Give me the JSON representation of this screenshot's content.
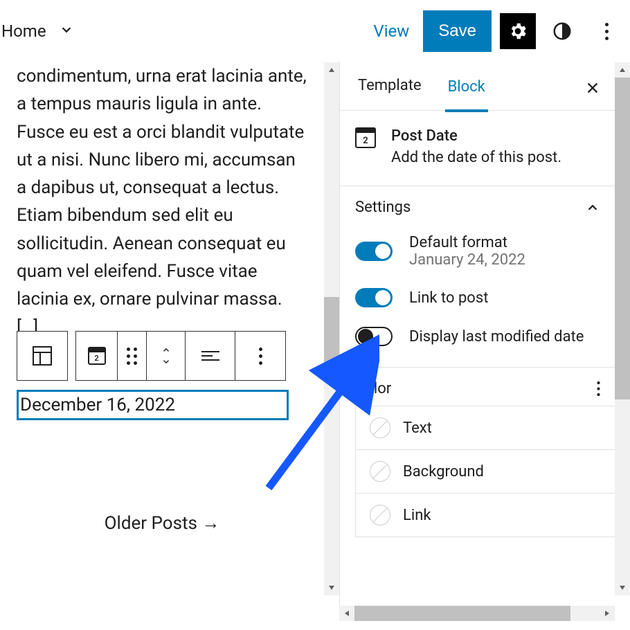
{
  "header": {
    "breadcrumb": "Home",
    "view": "View",
    "save": "Save"
  },
  "editor": {
    "body_text": "condimentum, urna erat lacinia ante, a tempus mauris ligula in ante. Fusce eu est a orci blandit vulputate ut a nisi. Nunc libero mi, accumsan a dapibus ut, consequat a lectus. Etiam bibendum sed elit eu sollicitudin. Aenean consequat eu quam vel eleifend. Fusce vitae lacinia ex, ornare pulvinar massa. […]",
    "date_value": "December 16, 2022",
    "older_posts": "Older Posts  →",
    "calendar_day": "2"
  },
  "sidebar": {
    "tabs": {
      "template": "Template",
      "block": "Block"
    },
    "block_info": {
      "title": "Post Date",
      "description": "Add the date of this post.",
      "calendar_day": "2"
    },
    "sections": {
      "settings_title": "Settings",
      "color_title": "Color"
    },
    "settings": {
      "default_format": {
        "label": "Default format",
        "sub": "January 24, 2022",
        "on": true
      },
      "link_to_post": {
        "label": "Link to post",
        "on": true
      },
      "display_modified": {
        "label": "Display last modified date",
        "on": false
      }
    },
    "color": {
      "text": "Text",
      "background": "Background",
      "link": "Link"
    }
  }
}
